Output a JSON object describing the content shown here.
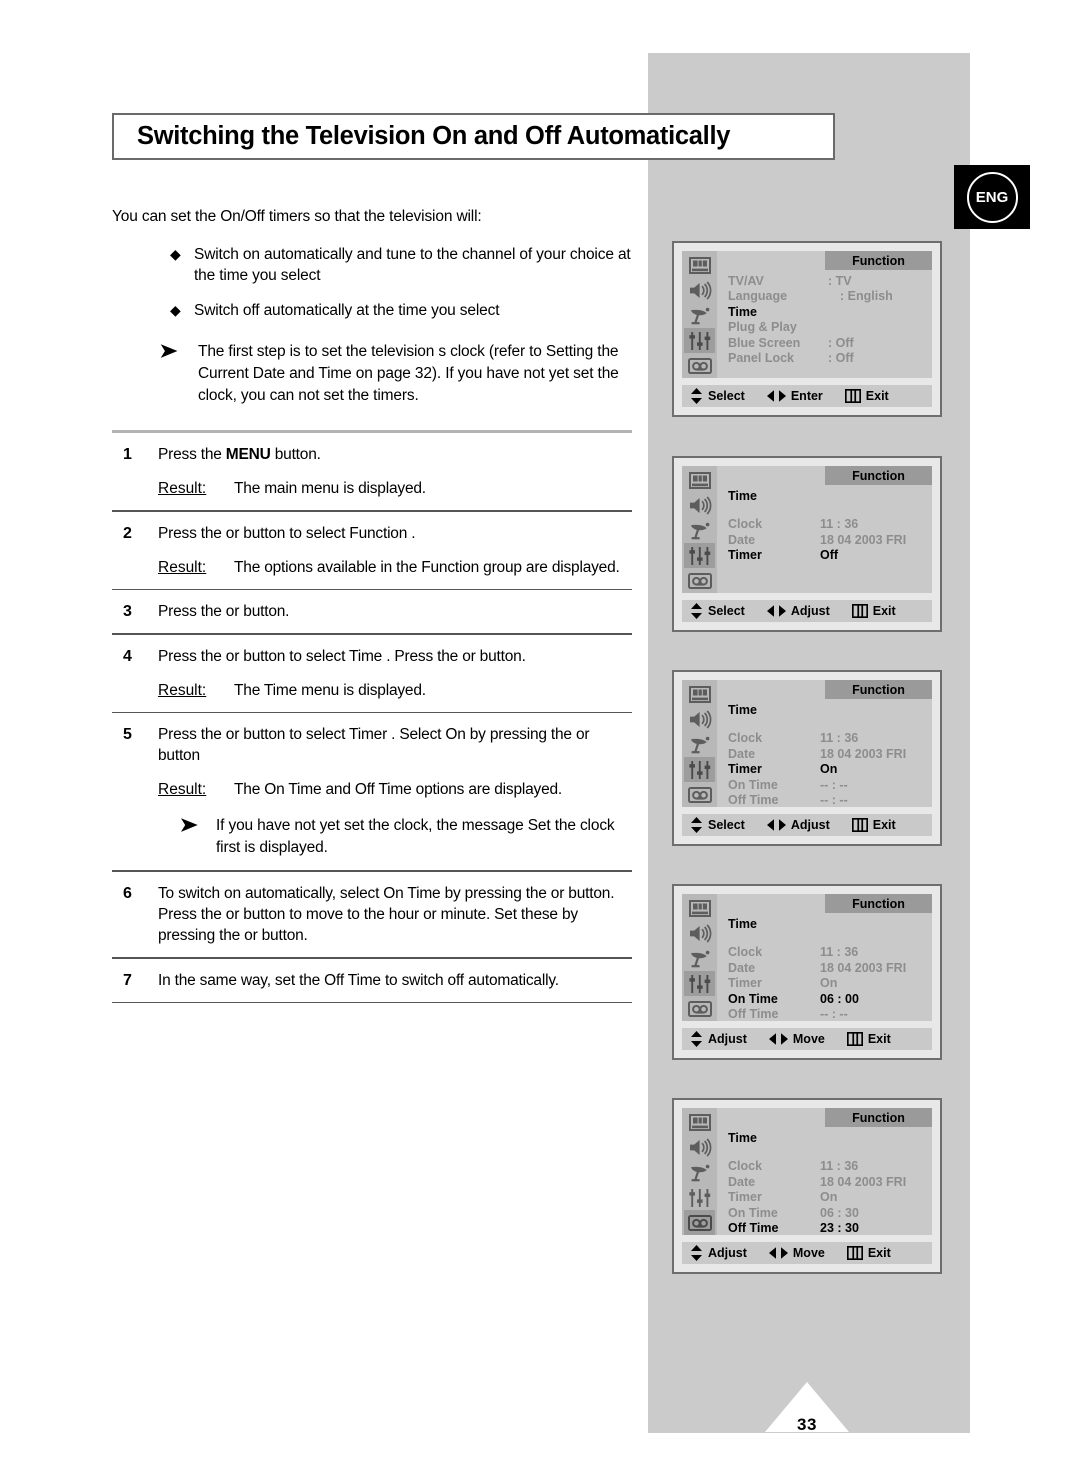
{
  "page": {
    "title": "Switching the Television On and Off Automatically",
    "number": "33",
    "lang_badge": "ENG"
  },
  "intro": {
    "text": "You can set the On/Off timers so that the television will:"
  },
  "bullets": [
    {
      "mark": "◆",
      "text": "Switch on automatically and tune to the channel of your choice at the time you select"
    },
    {
      "mark": "◆",
      "text": "Switch off automatically at the time you select"
    }
  ],
  "top_note": {
    "arrow": "➤",
    "text": "The first step is to set the television s clock (refer to  Setting the Current Date and Time  on page 32). If you have not yet set the clock, you can not set the timers."
  },
  "steps": [
    {
      "num": "1",
      "lines": [
        "Press the MENU button."
      ],
      "bold_word": "MENU",
      "result_label": "Result:",
      "result": "The main menu is displayed."
    },
    {
      "num": "2",
      "lines": [
        "Press the     or     button to select Function   ."
      ],
      "result_label": "Result:",
      "result": "The options available in the Function     group are displayed."
    },
    {
      "num": "3",
      "lines": [
        "Press the    or    button."
      ],
      "result_label": "",
      "result": ""
    },
    {
      "num": "4",
      "lines": [
        "Press the    or    button to select Time . Press the    or    button."
      ],
      "result_label": "Result:",
      "result": "The  Time   menu is displayed."
    },
    {
      "num": "5",
      "lines": [
        "Press the    or    button to select Timer . Select On by pressing the    or    button"
      ],
      "result_label": "Result:",
      "result": "The  On Time   and  Off Time      options are displayed.",
      "note_arrow": "➤",
      "note": "If you have not yet set the clock, the message  Set the clock first          is displayed."
    },
    {
      "num": "6",
      "lines": [
        "To switch on automatically, select On Time  by pressing the     or     button. Press the    or    button to move to the hour or minute. Set these by pressing the    or    button."
      ],
      "result_label": "",
      "result": ""
    },
    {
      "num": "7",
      "lines": [
        "In the same way, set the Off Time     to switch off automatically."
      ],
      "result_label": "",
      "result": ""
    }
  ],
  "osd_icons": [
    "picture-icon",
    "sound-icon",
    "channel-icon",
    "function-icon",
    "vcr-icon"
  ],
  "osd_panels": [
    {
      "header": "Function",
      "selected_icon_index": 3,
      "rows": [
        {
          "label": "TV/AV",
          "value": ": TV",
          "label_state": "dim",
          "value_state": "dim"
        },
        {
          "label": "Language",
          "value": ": English",
          "label_state": "dim",
          "value_state": "dim",
          "value_left": true
        },
        {
          "label": "Time",
          "value": "",
          "label_state": "bright",
          "value_state": "dim"
        },
        {
          "label": "Plug & Play",
          "value": "",
          "label_state": "dim",
          "value_state": "dim"
        },
        {
          "label": "Blue Screen",
          "value": ": Off",
          "label_state": "dim",
          "value_state": "dim"
        },
        {
          "label": "Panel Lock",
          "value": ": Off",
          "label_state": "dim",
          "value_state": "dim"
        }
      ],
      "footer": [
        {
          "icon": "updown-arrow-icon",
          "label": "Select"
        },
        {
          "icon": "leftright-arrow-icon",
          "label": "Enter"
        },
        {
          "icon": "menu-bars-icon",
          "label": "Exit"
        }
      ]
    },
    {
      "header": "Function",
      "selected_icon_index": 3,
      "title_row": {
        "label": "Time",
        "state": "bright"
      },
      "rows": [
        {
          "label": "Clock",
          "value": "11 : 36",
          "label_state": "dim",
          "value_state": "dim"
        },
        {
          "label": "Date",
          "value": "18 04 2003 FRI",
          "label_state": "dim",
          "value_state": "dim"
        },
        {
          "label": "Timer",
          "value": "Off",
          "label_state": "bright",
          "value_state": "bright"
        }
      ],
      "footer": [
        {
          "icon": "updown-arrow-icon",
          "label": "Select"
        },
        {
          "icon": "leftright-arrow-icon",
          "label": "Adjust"
        },
        {
          "icon": "menu-bars-icon",
          "label": "Exit"
        }
      ]
    },
    {
      "header": "Function",
      "selected_icon_index": 3,
      "title_row": {
        "label": "Time",
        "state": "bright"
      },
      "rows": [
        {
          "label": "Clock",
          "value": "11 : 36",
          "label_state": "dim",
          "value_state": "dim"
        },
        {
          "label": "Date",
          "value": "18 04 2003 FRI",
          "label_state": "dim",
          "value_state": "dim"
        },
        {
          "label": "Timer",
          "value": "On",
          "label_state": "bright",
          "value_state": "bright"
        },
        {
          "label": "On Time",
          "value": "-- : --",
          "label_state": "dim",
          "value_state": "dim"
        },
        {
          "label": "Off Time",
          "value": "-- : --",
          "label_state": "dim",
          "value_state": "dim"
        }
      ],
      "footer": [
        {
          "icon": "updown-arrow-icon",
          "label": "Select"
        },
        {
          "icon": "leftright-arrow-icon",
          "label": "Adjust"
        },
        {
          "icon": "menu-bars-icon",
          "label": "Exit"
        }
      ]
    },
    {
      "header": "Function",
      "selected_icon_index": 3,
      "title_row": {
        "label": "Time",
        "state": "bright"
      },
      "rows": [
        {
          "label": "Clock",
          "value": "11 : 36",
          "label_state": "dim",
          "value_state": "dim"
        },
        {
          "label": "Date",
          "value": "18 04 2003 FRI",
          "label_state": "dim",
          "value_state": "dim"
        },
        {
          "label": "Timer",
          "value": "On",
          "label_state": "dim",
          "value_state": "dim"
        },
        {
          "label": "On Time",
          "value": "06 : 00",
          "label_state": "bright",
          "value_state": "bright"
        },
        {
          "label": "Off Time",
          "value": "-- : --",
          "label_state": "dim",
          "value_state": "dim"
        }
      ],
      "footer": [
        {
          "icon": "updown-arrow-icon",
          "label": "Adjust"
        },
        {
          "icon": "leftright-arrow-icon",
          "label": "Move"
        },
        {
          "icon": "menu-bars-icon",
          "label": "Exit"
        }
      ]
    },
    {
      "header": "Function",
      "selected_icon_index": 4,
      "title_row": {
        "label": "Time",
        "state": "bright"
      },
      "rows": [
        {
          "label": "Clock",
          "value": "11 : 36",
          "label_state": "dim",
          "value_state": "dim"
        },
        {
          "label": "Date",
          "value": "18 04 2003 FRI",
          "label_state": "dim",
          "value_state": "dim"
        },
        {
          "label": "Timer",
          "value": "On",
          "label_state": "dim",
          "value_state": "dim"
        },
        {
          "label": "On Time",
          "value": "06 : 30",
          "label_state": "dim",
          "value_state": "dim"
        },
        {
          "label": "Off Time",
          "value": "23 : 30",
          "label_state": "bright",
          "value_state": "bright"
        }
      ],
      "footer": [
        {
          "icon": "updown-arrow-icon",
          "label": "Adjust"
        },
        {
          "icon": "leftright-arrow-icon",
          "label": "Move"
        },
        {
          "icon": "menu-bars-icon",
          "label": "Exit"
        }
      ]
    }
  ],
  "colors": {
    "panel_gray": "#cbcbcb",
    "osd_screen": "#c9c9c9",
    "osd_header": "#9a9a9a",
    "osd_dim_text": "#8d8d8d",
    "osd_bright_text": "#000000"
  }
}
